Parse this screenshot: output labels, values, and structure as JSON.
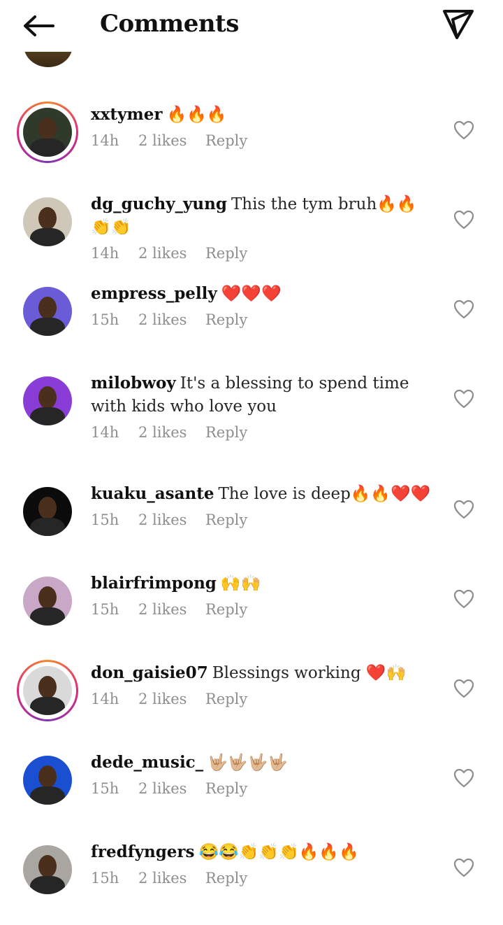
{
  "header": {
    "title": "Comments"
  },
  "comments": [
    {
      "username": "xxtymer",
      "text": "🔥🔥🔥",
      "time": "14h",
      "likes": "2 likes",
      "reply": "Reply",
      "avatar_color": "#2f3a2a",
      "ring": true
    },
    {
      "username": "dg_guchy_yung",
      "text": "This the tym bruh🔥🔥👏👏",
      "time": "14h",
      "likes": "2 likes",
      "reply": "Reply",
      "avatar_color": "#cfc7b8",
      "ring": false
    },
    {
      "username": "empress_pelly",
      "text": "❤️❤️❤️",
      "time": "15h",
      "likes": "2 likes",
      "reply": "Reply",
      "avatar_color": "#6a5bd6",
      "ring": false
    },
    {
      "username": "milobwoy",
      "text": "It's a blessing to spend time with kids who love you",
      "time": "14h",
      "likes": "2 likes",
      "reply": "Reply",
      "avatar_color": "#8a3dd6",
      "ring": false
    },
    {
      "username": "kuaku_asante",
      "text": "The love is deep🔥🔥❤️❤️",
      "time": "15h",
      "likes": "2 likes",
      "reply": "Reply",
      "avatar_color": "#0b0b0b",
      "ring": false
    },
    {
      "username": "blairfrimpong",
      "text": "🙌🙌",
      "time": "15h",
      "likes": "2 likes",
      "reply": "Reply",
      "avatar_color": "#c9a7c6",
      "ring": false
    },
    {
      "username": "don_gaisie07",
      "text": "Blessings working ❤️🙌",
      "time": "14h",
      "likes": "2 likes",
      "reply": "Reply",
      "avatar_color": "#d9d9d9",
      "ring": true
    },
    {
      "username": "dede_music_",
      "text": "🤟🏼🤟🏼🤟🏼🤟🏼",
      "time": "15h",
      "likes": "2 likes",
      "reply": "Reply",
      "avatar_color": "#1b4fd1",
      "ring": false
    },
    {
      "username": "fredfyngers",
      "text": "😂😂👏👏👏🔥🔥🔥",
      "time": "15h",
      "likes": "2 likes",
      "reply": "Reply",
      "avatar_color": "#a9a6a2",
      "ring": false
    }
  ]
}
